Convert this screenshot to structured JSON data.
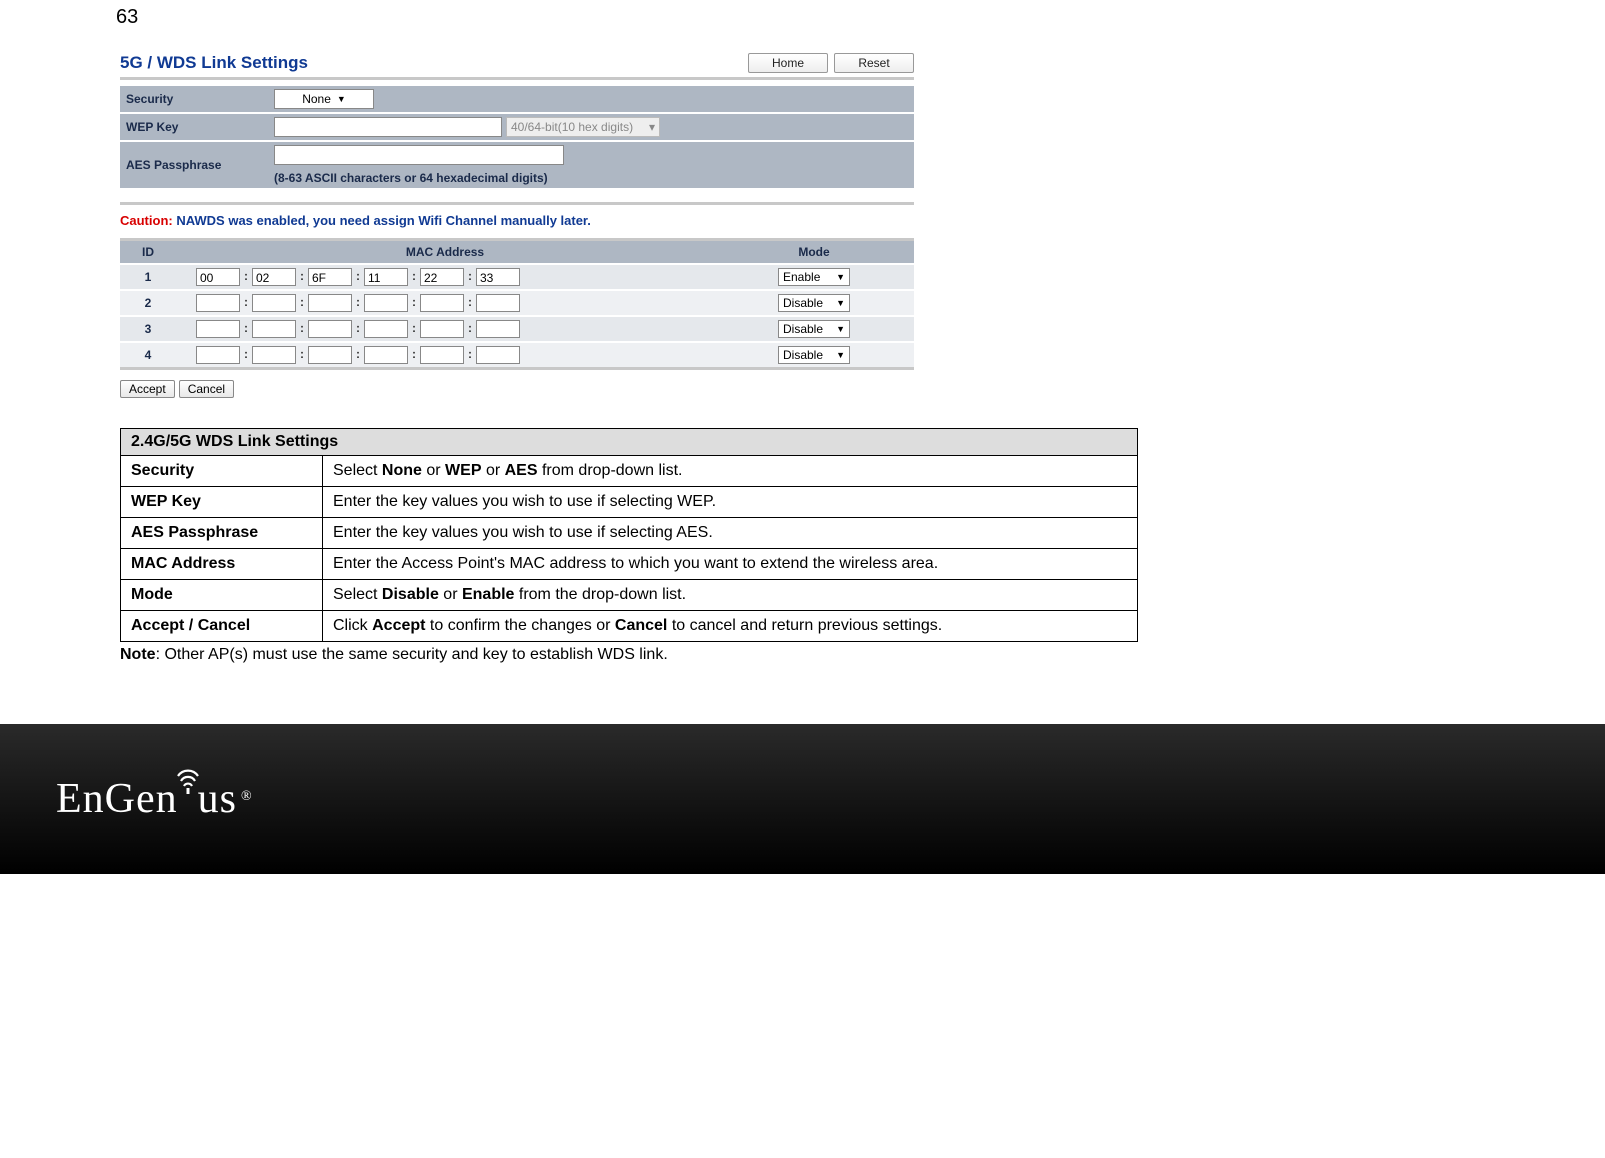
{
  "page_number": "63",
  "screenshot": {
    "title": "5G / WDS Link Settings",
    "buttons": {
      "home": "Home",
      "reset": "Reset"
    },
    "rows": {
      "security": {
        "label": "Security",
        "value": "None"
      },
      "wepkey": {
        "label": "WEP Key",
        "value": "",
        "format": "40/64-bit(10 hex digits)"
      },
      "aes": {
        "label": "AES Passphrase",
        "value": "",
        "hint": "(8-63 ASCII characters or 64 hexadecimal digits)"
      }
    },
    "caution": {
      "label": "Caution:",
      "text": "NAWDS was enabled, you need assign Wifi Channel manually later."
    },
    "mac": {
      "head": {
        "id": "ID",
        "mac": "MAC Address",
        "mode": "Mode"
      },
      "rows": [
        {
          "id": "1",
          "oct": [
            "00",
            "02",
            "6F",
            "11",
            "22",
            "33"
          ],
          "mode": "Enable"
        },
        {
          "id": "2",
          "oct": [
            "",
            "",
            "",
            "",
            "",
            ""
          ],
          "mode": "Disable"
        },
        {
          "id": "3",
          "oct": [
            "",
            "",
            "",
            "",
            "",
            ""
          ],
          "mode": "Disable"
        },
        {
          "id": "4",
          "oct": [
            "",
            "",
            "",
            "",
            "",
            ""
          ],
          "mode": "Disable"
        }
      ]
    },
    "bottom": {
      "accept": "Accept",
      "cancel": "Cancel"
    }
  },
  "desc": {
    "header": "2.4G/5G WDS Link Settings",
    "rows": [
      {
        "k": "Security",
        "pre": "Select ",
        "b1": "None",
        "mid1": " or ",
        "b2": "WEP",
        "mid2": " or ",
        "b3": "AES",
        "post": " from drop-down list."
      },
      {
        "k": "WEP Key",
        "plain": "Enter the key values you wish to use if selecting WEP."
      },
      {
        "k": "AES Passphrase",
        "plain": "Enter the key values you wish to use if selecting AES."
      },
      {
        "k": "MAC Address",
        "plain": "Enter the Access Point's MAC address to which you want to extend the wireless area."
      },
      {
        "k": "Mode",
        "pre": "Select ",
        "b1": "Disable",
        "mid1": " or ",
        "b2": "Enable",
        "post": " from the drop-down list."
      },
      {
        "k": "Accept / Cancel",
        "pre": "Click ",
        "b1": "Accept",
        "mid1": " to confirm the changes or ",
        "b2": "Cancel",
        "post": " to cancel and return previous settings."
      }
    ]
  },
  "note": {
    "label": "Note",
    "text": ": Other AP(s) must use the same security and key to establish WDS link."
  },
  "footer": {
    "brand_a": "EnGen",
    "brand_b": "us",
    "wifi_glyph": "◜◜",
    "reg": "®"
  }
}
